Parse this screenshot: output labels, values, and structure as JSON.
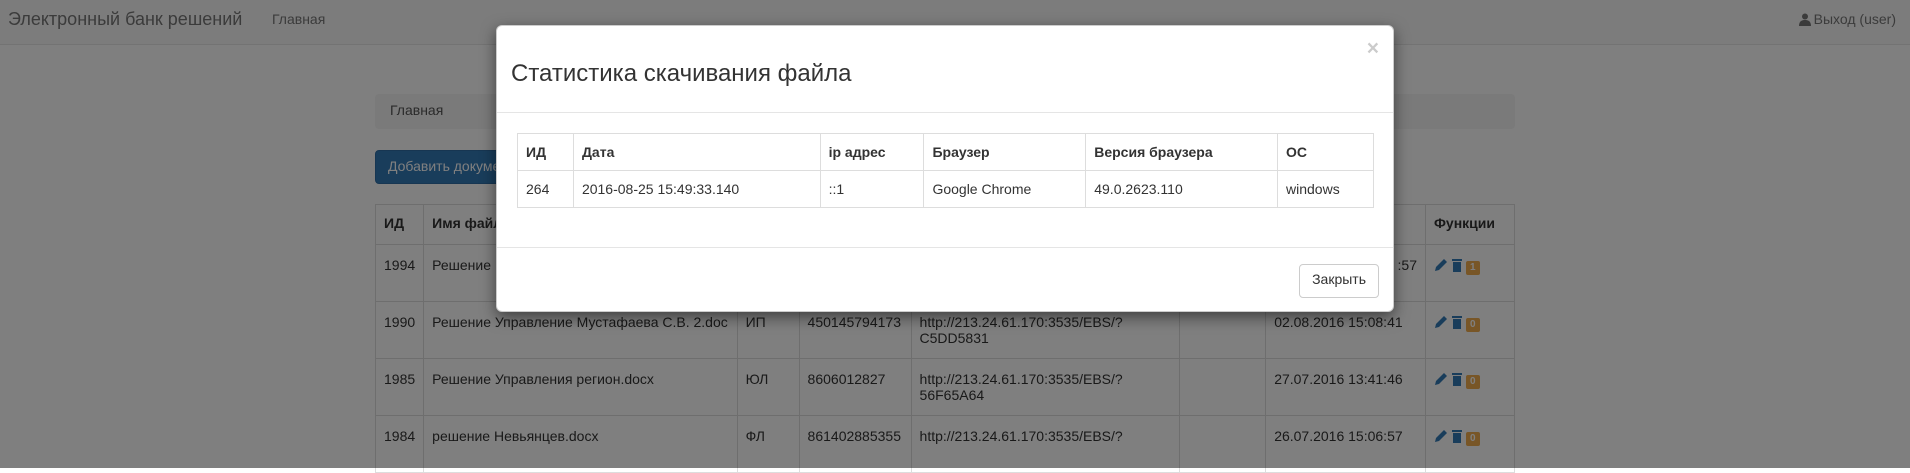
{
  "navbar": {
    "brand": "Электронный банк решений",
    "home": "Главная",
    "logout": "Выход (user)"
  },
  "breadcrumb": "Главная",
  "add_button": "Добавить документ",
  "table": {
    "headers": [
      "ИД",
      "Имя файла",
      "",
      "",
      "",
      "",
      "",
      "Функции"
    ],
    "rows": [
      {
        "id": "1994",
        "name": "Решение",
        "type": "",
        "inn": "",
        "url": "",
        "extra": "",
        "date": ":57",
        "count": "1"
      },
      {
        "id": "1990",
        "name": "Решение Управление Мустафаева С.В. 2.doc",
        "type": "ИП",
        "inn": "450145794173",
        "url": "http://213.24.61.170:3535/EBS/?C5DD5831",
        "extra": "",
        "date": "02.08.2016 15:08:41",
        "count": "0"
      },
      {
        "id": "1985",
        "name": "Решение Управления регион.docx",
        "type": "ЮЛ",
        "inn": "8606012827",
        "url": "http://213.24.61.170:3535/EBS/?56F65A64",
        "extra": "",
        "date": "27.07.2016 13:41:46",
        "count": "0"
      },
      {
        "id": "1984",
        "name": "решение Невьянцев.docx",
        "type": "ФЛ",
        "inn": "861402885355",
        "url": "http://213.24.61.170:3535/EBS/?",
        "extra": "",
        "date": "26.07.2016 15:06:57",
        "count": "0"
      }
    ]
  },
  "modal": {
    "title": "Статистика скачивания файла",
    "close_symbol": "×",
    "headers": {
      "id": "ИД",
      "date": "Дата",
      "ip": "ip адрес",
      "browser": "Браузер",
      "version": "Версия браузера",
      "os": "ОС"
    },
    "row": {
      "id": "264",
      "date": "2016-08-25 15:49:33.140",
      "ip": "::1",
      "browser": "Google Chrome",
      "version": "49.0.2623.110",
      "os": "windows"
    },
    "close_button": "Закрыть"
  },
  "colors": {
    "primary": "#337ab7",
    "badge": "#f0ad4e",
    "icon_blue": "#337ab7"
  }
}
